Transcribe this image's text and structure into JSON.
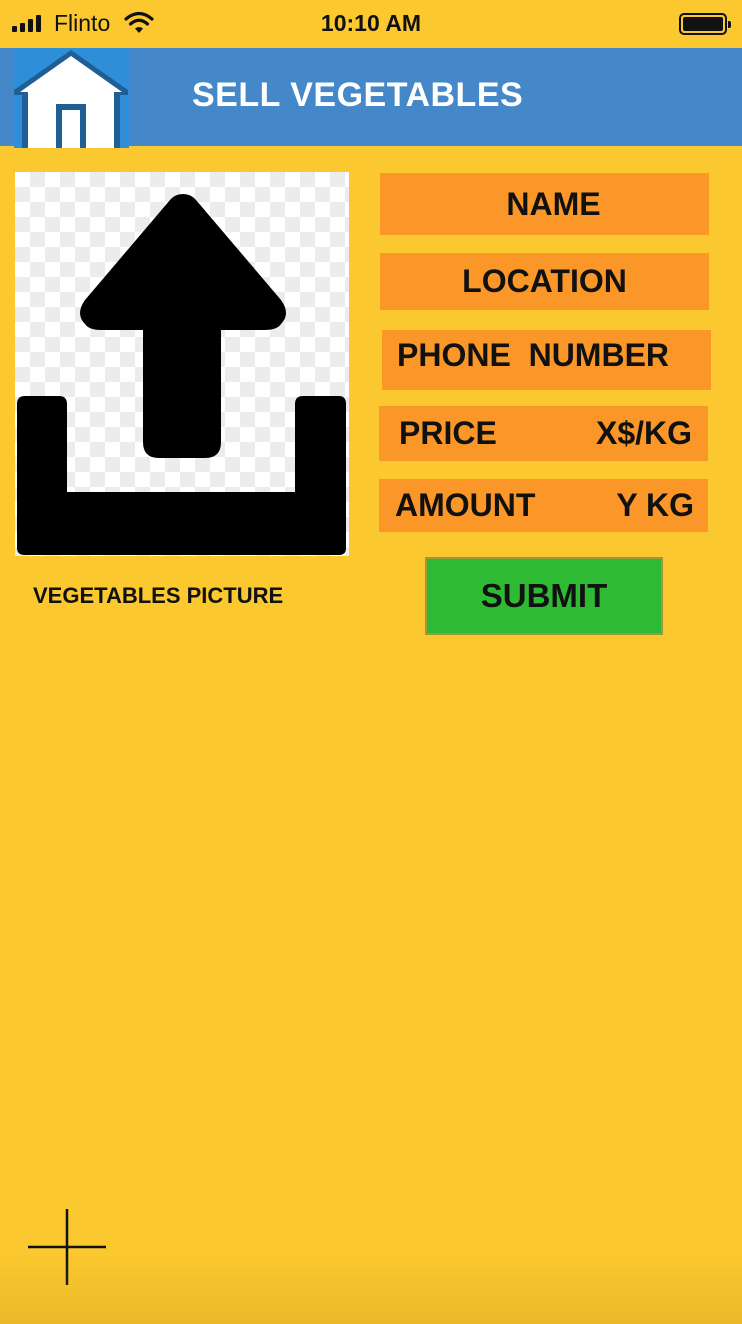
{
  "status_bar": {
    "carrier": "Flinto",
    "time": "10:10 AM",
    "signal_icon": "signal-bars-icon",
    "wifi_icon": "wifi-icon",
    "battery_icon": "battery-icon",
    "battery_level": 1.0
  },
  "navbar": {
    "title": "SELL VEGETABLES",
    "home_icon": "home-icon",
    "color": "#4588C9"
  },
  "upload": {
    "icon": "upload-icon",
    "label": "VEGETABLES PICTURE"
  },
  "form": {
    "name": "NAME",
    "location": "LOCATION",
    "phone": "PHONE  NUMBER",
    "price_label": "PRICE",
    "price_value": "X$/KG",
    "amount_label": "AMOUNT",
    "amount_value": "Y KG",
    "submit": "SUBMIT",
    "field_color": "#FB9629",
    "submit_color": "#2EBB33"
  },
  "fab": {
    "icon": "plus-icon"
  },
  "colors": {
    "background": "#FBC82F"
  }
}
